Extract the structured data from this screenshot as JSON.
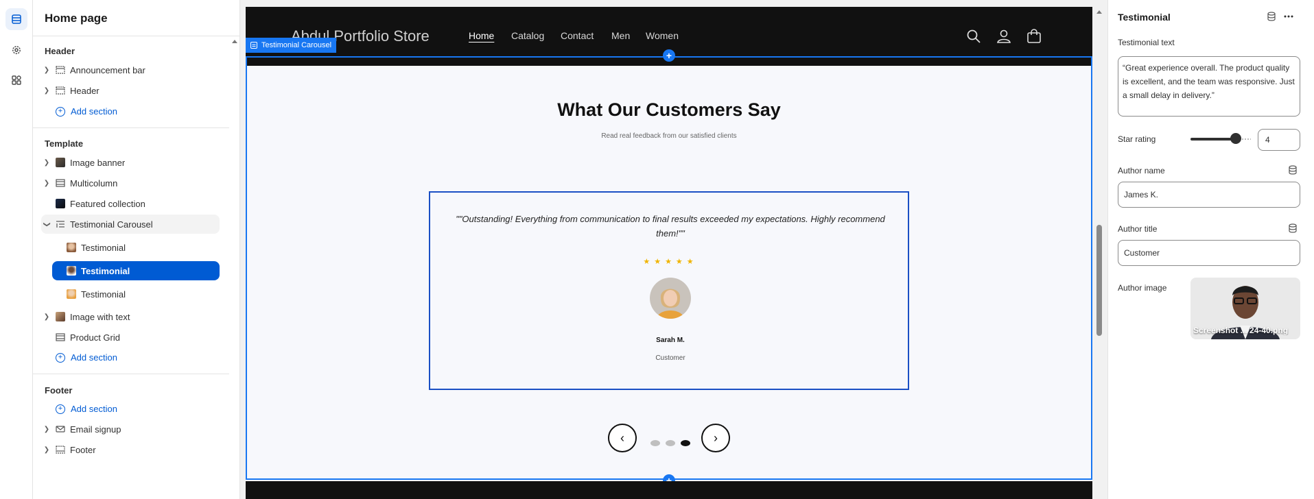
{
  "left_panel": {
    "title": "Home page",
    "header_group": "Header",
    "header_items": [
      "Announcement bar",
      "Header"
    ],
    "add_section": "Add section",
    "template_group": "Template",
    "template_items": {
      "image_banner": "Image banner",
      "multicolumn": "Multicolumn",
      "featured_collection": "Featured collection",
      "testimonial_carousel": "Testimonial Carousel",
      "testimonial_blocks": [
        "Testimonial",
        "Testimonial",
        "Testimonial"
      ],
      "image_with_text": "Image with text",
      "product_grid": "Product Grid"
    },
    "footer_group": "Footer",
    "footer_items": [
      "Email signup",
      "Footer"
    ]
  },
  "preview": {
    "store_name": "Abdul Portfolio Store",
    "nav": [
      "Home",
      "Catalog",
      "Contact",
      "Men",
      "Women"
    ],
    "selected_section_tag": "Testimonial Carousel",
    "heading": "What Our Customers Say",
    "subheading": "Read real feedback from our satisfied clients",
    "quote": "\"\"Outstanding! Everything from communication to final results exceeded my expectations. Highly recommend them!\"\"",
    "stars": "★★★★★",
    "rating": 5,
    "author": "Sarah M.",
    "author_role": "Customer",
    "slides": 3,
    "active_slide": 3,
    "prev_arrow": "‹",
    "next_arrow": "›"
  },
  "right_panel": {
    "title": "Testimonial",
    "testimonial_text_label": "Testimonial text",
    "testimonial_text": "“Great experience overall. The product quality is excellent, and the team was responsive. Just a small delay in delivery.”",
    "star_rating_label": "Star rating",
    "star_rating": "4",
    "author_name_label": "Author name",
    "author_name": "James K.",
    "author_title_label": "Author title",
    "author_title": "Customer",
    "author_image_label": "Author image",
    "author_image_file": "Screenshot ... 24-40.png"
  },
  "colors": {
    "accent": "#005bd3",
    "selection": "#1877f2",
    "star": "#f0b400",
    "store_header": "#111111"
  }
}
